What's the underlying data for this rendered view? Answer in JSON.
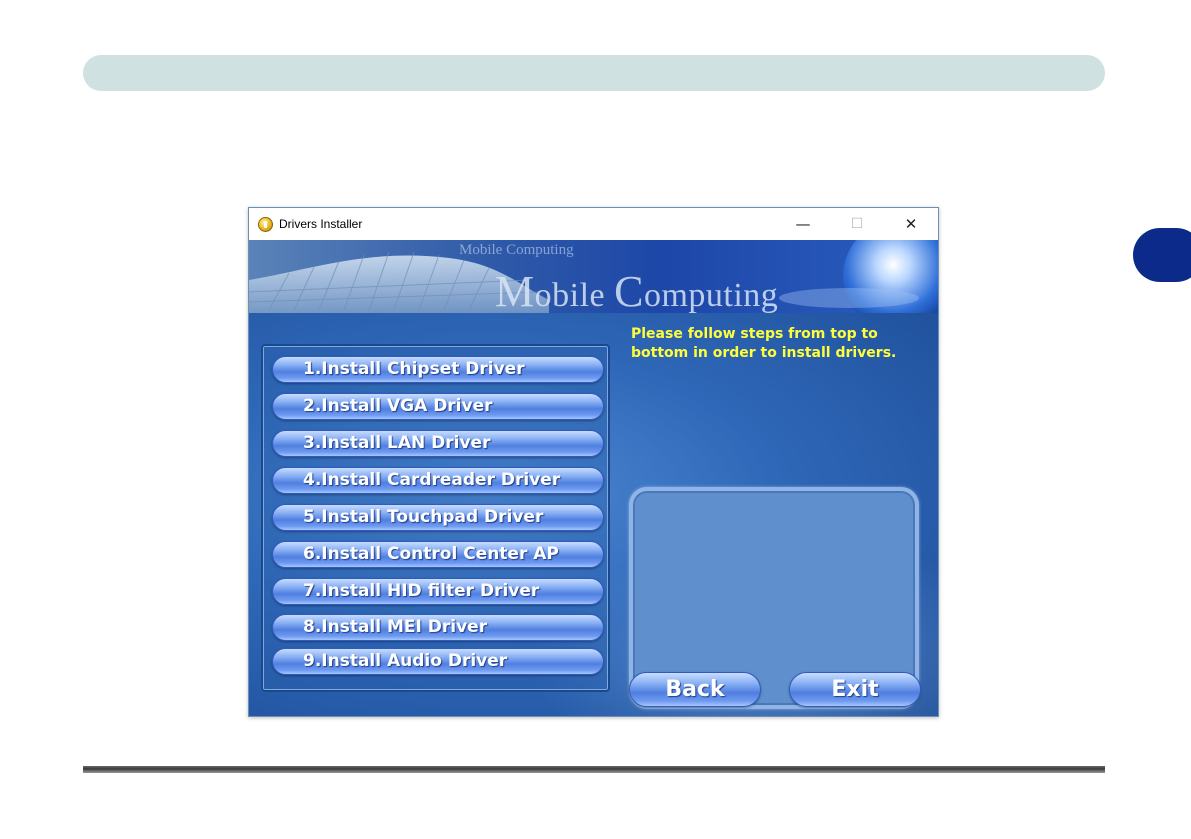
{
  "window": {
    "title": "Drivers Installer",
    "controls": {
      "minimize": "—",
      "maximize": "☐",
      "close": "✕"
    }
  },
  "banner": {
    "small_text": "Mobile Computing",
    "large_m": "M",
    "large_obile": "obile ",
    "large_c": "C",
    "large_omputing": "omputing"
  },
  "instructions": "Please follow steps from top to bottom in order to install drivers.",
  "steps": [
    "1.Install Chipset Driver",
    "2.Install VGA Driver",
    "3.Install LAN Driver",
    "4.Install Cardreader Driver",
    "5.Install Touchpad Driver",
    "6.Install Control Center AP",
    "7.Install HID filter Driver",
    "8.Install MEI Driver",
    "9.Install Audio Driver"
  ],
  "buttons": {
    "back": "Back",
    "exit": "Exit"
  },
  "colors": {
    "instruction_text": "#ffff3c",
    "page_top_bar": "#cfe1e1",
    "chapter_tab": "#0c2a8a"
  }
}
